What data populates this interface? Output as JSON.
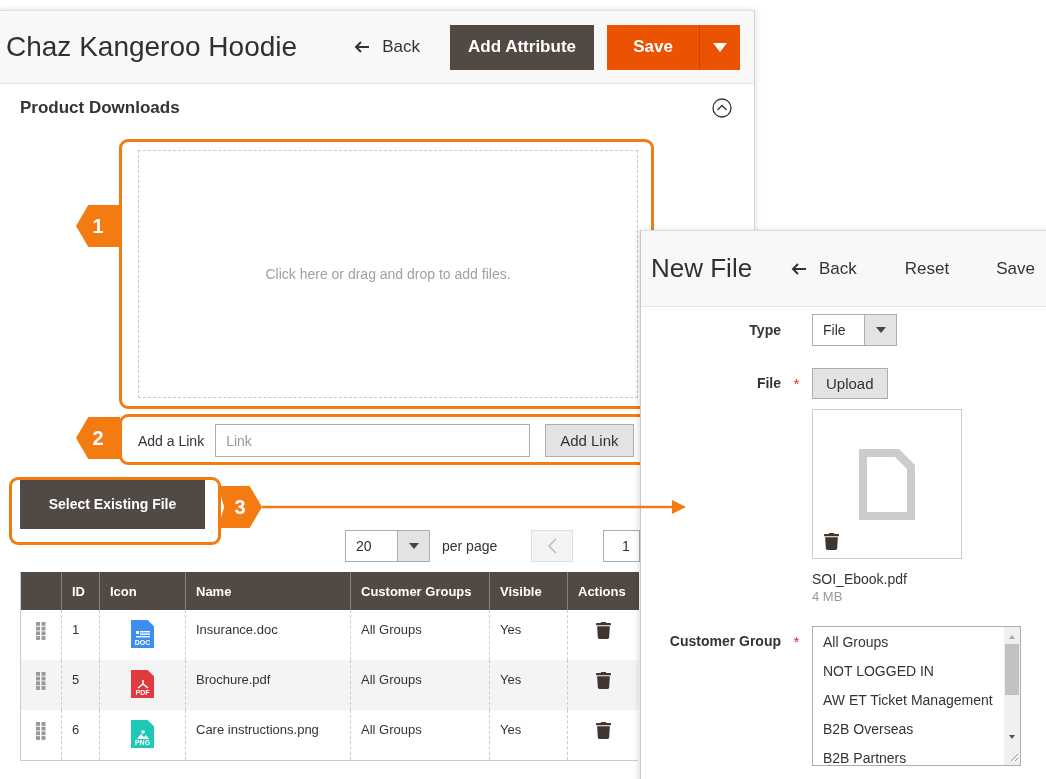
{
  "main": {
    "title": "Chaz Kangeroo Hoodie",
    "back": "Back",
    "add_attribute": "Add Attribute",
    "save": "Save"
  },
  "section": {
    "title": "Product Downloads",
    "expanded": true
  },
  "dropzone": {
    "text": "Click here or drag and drop to add files."
  },
  "link": {
    "label": "Add a Link",
    "placeholder": "Link",
    "button": "Add Link"
  },
  "select_existing": "Select Existing File",
  "pager": {
    "per_page_value": "20",
    "per_page_label": "per page",
    "page": "1"
  },
  "table": {
    "columns": [
      "ID",
      "Icon",
      "Name",
      "Customer Groups",
      "Visible",
      "Actions"
    ],
    "rows": [
      {
        "id": "1",
        "icon": {
          "kind": "doc",
          "label": "DOC",
          "color": "#3c8ef0"
        },
        "name": "Insurance.doc",
        "groups": "All Groups",
        "visible": "Yes"
      },
      {
        "id": "5",
        "icon": {
          "kind": "pdf",
          "label": "PDF",
          "color": "#e0393e"
        },
        "name": "Brochure.pdf",
        "groups": "All Groups",
        "visible": "Yes"
      },
      {
        "id": "6",
        "icon": {
          "kind": "image",
          "label": "PNG",
          "color": "#1fc7b6"
        },
        "name": "Care instructions.png",
        "groups": "All Groups",
        "visible": "Yes"
      }
    ]
  },
  "callouts": [
    {
      "number": "1"
    },
    {
      "number": "2"
    },
    {
      "number": "3"
    }
  ],
  "new_file": {
    "title": "New File",
    "back": "Back",
    "reset": "Reset",
    "save": "Save",
    "type": {
      "label": "Type",
      "value": "File"
    },
    "file": {
      "label": "File",
      "required_mark": "*",
      "upload": "Upload",
      "file_name": "SOI_Ebook.pdf",
      "file_size": "4 MB"
    },
    "customer_group": {
      "label": "Customer Group",
      "required_mark": "*",
      "options": [
        "All Groups",
        "NOT LOGGED IN",
        "AW ET Ticket Management",
        "B2B Overseas",
        "B2B Partners"
      ]
    }
  }
}
